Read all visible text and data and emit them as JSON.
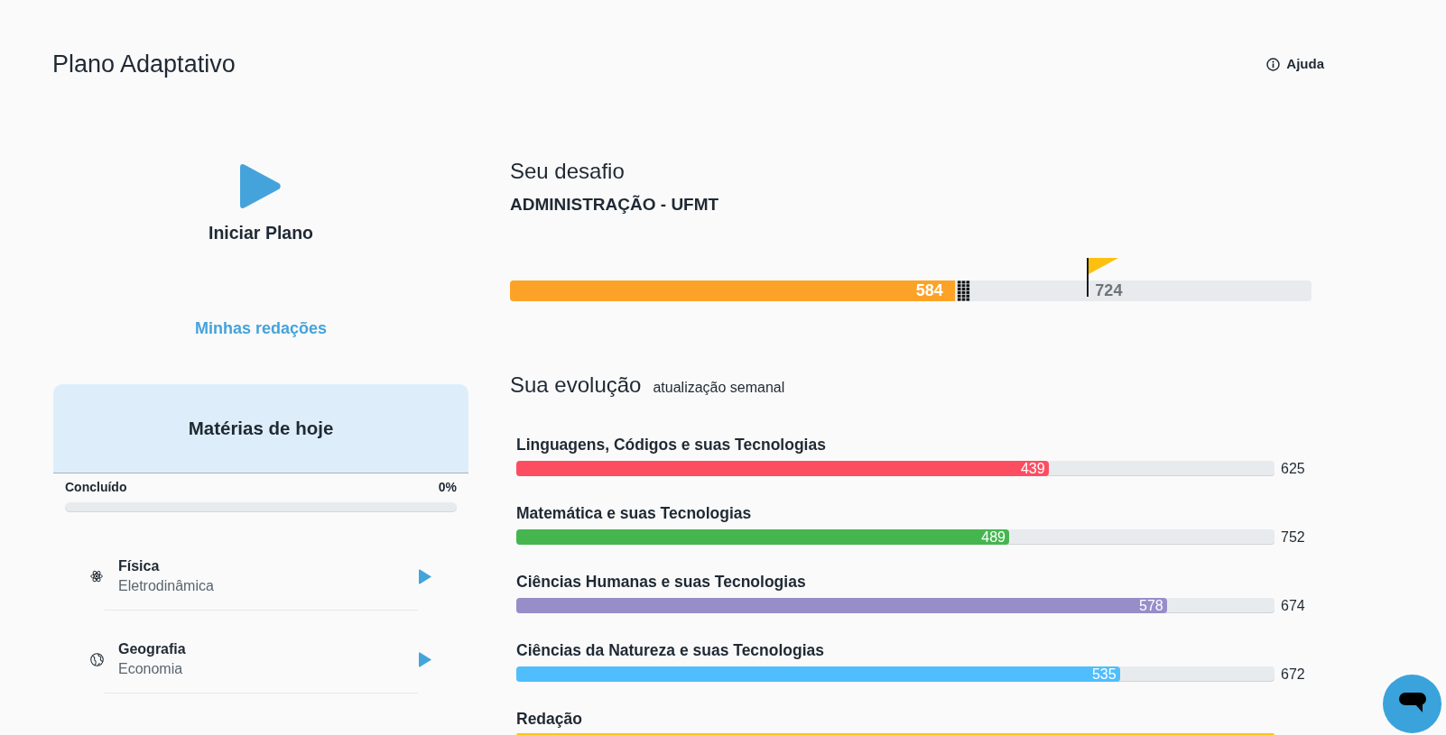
{
  "header": {
    "title": "Plano Adaptativo",
    "help": "Ajuda"
  },
  "plan": {
    "start": "Iniciar Plano",
    "essays_link": "Minhas redações"
  },
  "today": {
    "title": "Matérias de hoje",
    "progress": {
      "label": "Concluído",
      "reading": "0%",
      "level": 0
    },
    "subjects": [
      {
        "kind": "physics",
        "name": "Física",
        "topic": "Eletrodinâmica"
      },
      {
        "kind": "geography",
        "name": "Geografia",
        "topic": "Economia"
      }
    ]
  },
  "challenge": {
    "title": "Seu desafio",
    "course": "ADMINISTRAÇÃO - UFMT",
    "score": {
      "reading": "584",
      "level": 0.555
    },
    "target": {
      "reading": "724",
      "level": 0.72
    }
  },
  "evolution": {
    "title": "Sua evolução",
    "note": "atualização semanal",
    "areas": [
      {
        "name": "Linguagens, Códigos e suas Tecnologias",
        "score": "439",
        "level": 0.702,
        "target": "625",
        "color": "#fd4d60"
      },
      {
        "name": "Matemática e suas Tecnologias",
        "score": "489",
        "level": 0.65,
        "target": "752",
        "color": "#45b54f"
      },
      {
        "name": "Ciências Humanas e suas Tecnologias",
        "score": "578",
        "level": 0.858,
        "target": "674",
        "color": "#968dc9"
      },
      {
        "name": "Ciências da Natureza e suas Tecnologias",
        "score": "535",
        "level": 0.796,
        "target": "672",
        "color": "#50befc"
      },
      {
        "name": "Redação",
        "color": "#fdc517"
      }
    ]
  }
}
